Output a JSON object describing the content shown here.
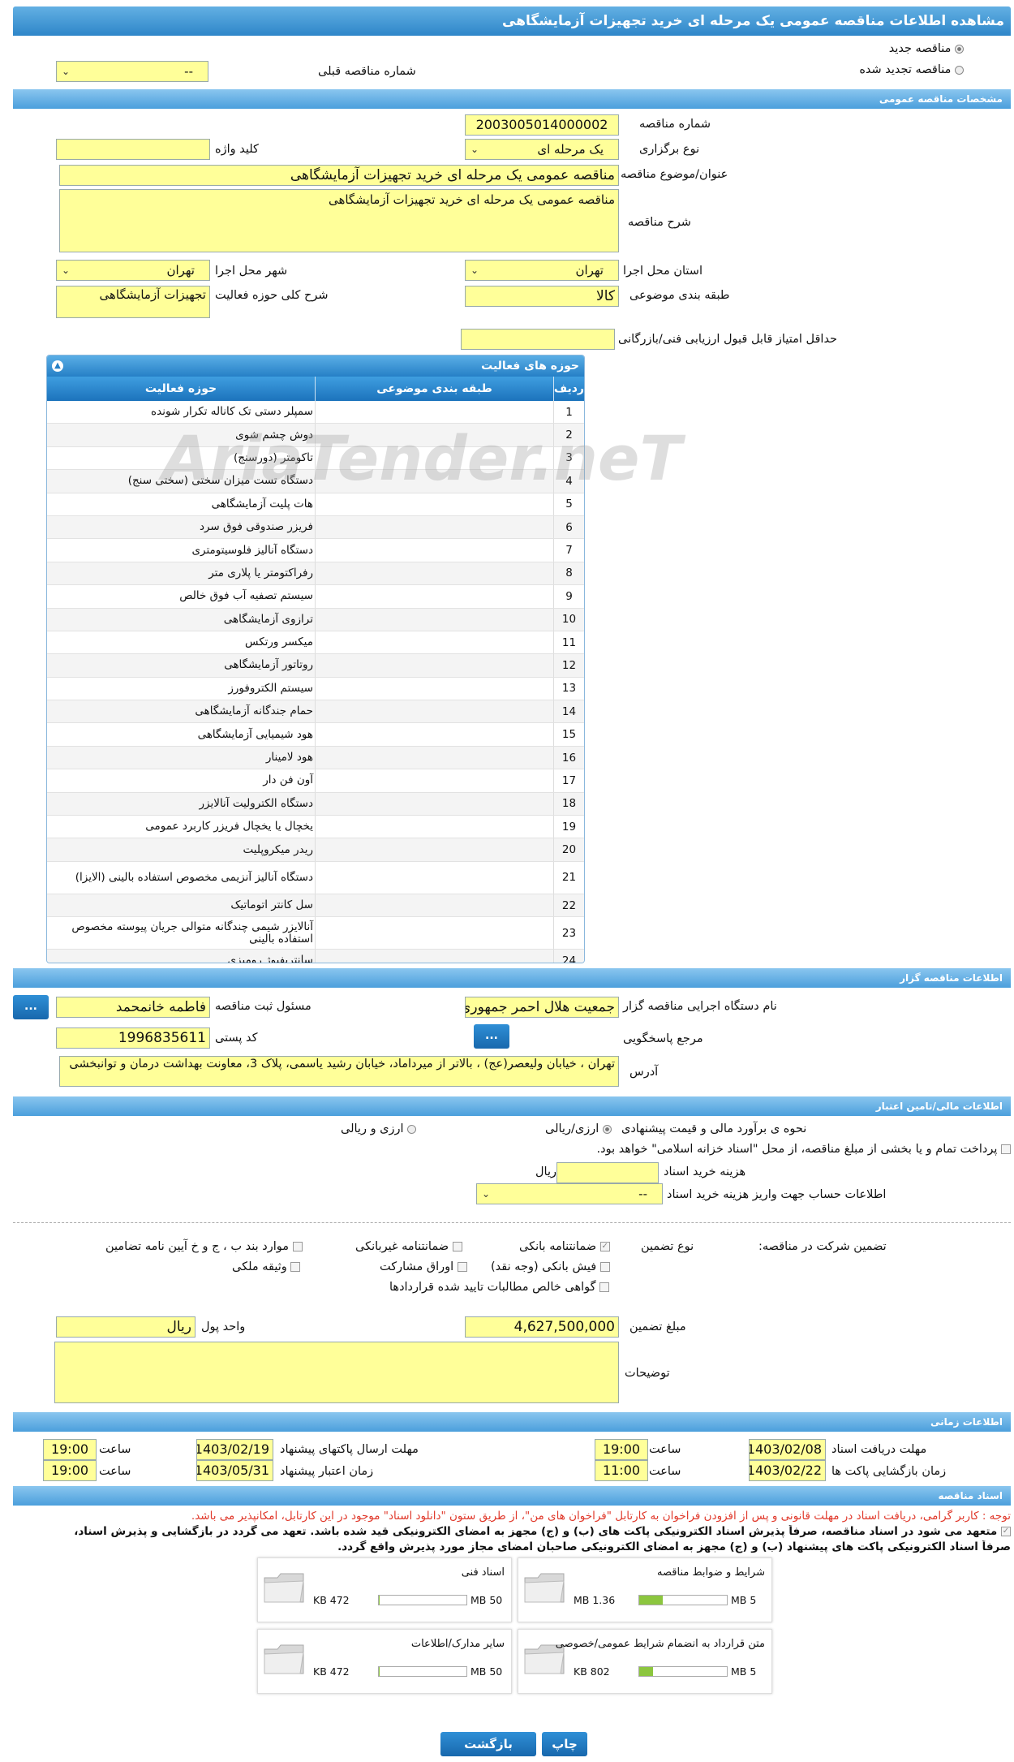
{
  "page": {
    "title": "مشاهده اطلاعات مناقصه عمومی یک مرحله ای خرید تجهیزات آزمایشگاهی"
  },
  "top": {
    "new_tender": "مناقصه جدید",
    "renewed_tender": "مناقصه تجدید شده",
    "prev_number_label": "شماره مناقصه قبلی",
    "prev_number_value": "--"
  },
  "general": {
    "header": "مشخصات مناقصه عمومی",
    "number_label": "شماره مناقصه",
    "number_value": "2003005014000002",
    "type_label": "نوع برگزاری",
    "type_value": "یک مرحله ای",
    "keyword_label": "کلید واژه",
    "keyword_value": "",
    "subject_label": "عنوان/موضوع مناقصه",
    "subject_value": "مناقصه عمومی یک مرحله ای خرید تجهیزات آزمایشگاهی",
    "desc_label": "شرح مناقصه",
    "desc_value": "مناقصه عمومی یک مرحله ای خرید تجهیزات آزمایشگاهی",
    "province_label": "استان محل اجرا",
    "province_value": "تهران",
    "city_label": "شهر محل اجرا",
    "city_value": "تهران",
    "category_label": "طبقه بندی موضوعی",
    "category_value": "کالا",
    "activity_label": "شرح کلی حوزه فعالیت",
    "activity_value": "تجهیزات آزمایشگاهی",
    "min_score_label": "حداقل امتیاز قابل قبول ارزیابی فنی/بازرگانی",
    "min_score_value": ""
  },
  "activities": {
    "header": "حوزه های فعالیت",
    "col_row": "ردیف",
    "col_category": "طبقه بندی موضوعی",
    "col_field": "حوزه فعالیت",
    "rows": [
      {
        "n": "1",
        "name": "سمپلر دستی تک کاناله تکرار شونده"
      },
      {
        "n": "2",
        "name": "دوش چشم شوی"
      },
      {
        "n": "3",
        "name": "تاکومتر (دورسنج)"
      },
      {
        "n": "4",
        "name": "دستگاه تست میزان سختی (سختی سنج)"
      },
      {
        "n": "5",
        "name": "هات پلیت آزمایشگاهی"
      },
      {
        "n": "6",
        "name": "فریزر صندوقی فوق سرد"
      },
      {
        "n": "7",
        "name": "دستگاه آنالیز فلوسیتومتری"
      },
      {
        "n": "8",
        "name": "رفراکتومتر یا پلاری متر"
      },
      {
        "n": "9",
        "name": "سیستم تصفیه آب فوق خالص"
      },
      {
        "n": "10",
        "name": "ترازوی آزمایشگاهی"
      },
      {
        "n": "11",
        "name": "میکسر ورتکس"
      },
      {
        "n": "12",
        "name": "روتاتور آزمایشگاهی"
      },
      {
        "n": "13",
        "name": "سیستم الکتروفورز"
      },
      {
        "n": "14",
        "name": "حمام جندگانه آزمایشگاهی"
      },
      {
        "n": "15",
        "name": "هود شیمیایی آزمایشگاهی"
      },
      {
        "n": "16",
        "name": "هود لامینار"
      },
      {
        "n": "17",
        "name": "آون فن دار"
      },
      {
        "n": "18",
        "name": "دستگاه الکترولیت آنالایزر"
      },
      {
        "n": "19",
        "name": "یخچال یا یخچال فریزر کاربرد عمومی"
      },
      {
        "n": "20",
        "name": "ریدر میکروپلیت"
      },
      {
        "n": "21",
        "name": "دستگاه آنالیز آنزیمی مخصوص استفاده بالینی (الایزا)"
      },
      {
        "n": "22",
        "name": "سل کانتر اتوماتیک"
      },
      {
        "n": "23",
        "name": "آنالایزر شیمی چندگانه متوالی جریان پیوسته مخصوص استفاده بالینی"
      },
      {
        "n": "24",
        "name": "سانتریفیوژ رومیزی"
      }
    ]
  },
  "organizer": {
    "header": "اطلاعات مناقصه گزار",
    "org_label": "نام دستگاه اجرایی مناقصه گزار",
    "org_value": "جمعیت هلال احمر جمهوری",
    "person_label": "مسئول ثبت مناقصه",
    "person_value": "فاطمه خانمحمد",
    "ref_label": "مرجع پاسخگویی",
    "postal_label": "کد پستی",
    "postal_value": "1996835611",
    "address_label": "آدرس",
    "address_value": "تهران ، خیابان ولیعصر(عج) ، بالاتر از میرداماد، خیابان رشید یاسمی، پلاک 3، معاونت بهداشت درمان و توانبخشی",
    "more_btn": "..."
  },
  "finance": {
    "header": "اطلاعات مالی/تامین اعتبار",
    "estimate_label": "نحوه ی برآورد مالی و قیمت پیشنهادی",
    "opt1": "ارزی/ریالی",
    "opt2": "ارزی و ریالی",
    "treasury_text": "پرداخت تمام و یا بخشی از مبلغ مناقصه، از محل \"اسناد خزانه اسلامی\" خواهد بود.",
    "doc_cost_label": "هزینه خرید اسناد",
    "doc_cost_unit": "ریال",
    "account_label": "اطلاعات حساب جهت واریز هزینه خرید اسناد",
    "account_value": "--",
    "guarantee_label": "تضمین شرکت در مناقصه:",
    "guarantee_type_label": "نوع تضمین",
    "g_bank": "ضمانتنامه بانکی",
    "g_nonbank": "ضمانتنامه غیربانکی",
    "g_items": "موارد بند ب ، ج و خ آیین نامه تضامین",
    "g_cheque": "فیش بانکی (وجه نقد)",
    "g_bonds": "اوراق مشارکت",
    "g_property": "وثیقه ملکی",
    "g_claims": "گواهی خالص مطالبات تایید شده قراردادها",
    "amount_label": "مبلغ تضمین",
    "amount_value": "4,627,500,000",
    "currency_label": "واحد پول",
    "currency_value": "ریال",
    "notes_label": "توضیحات"
  },
  "timing": {
    "header": "اطلاعات زمانی",
    "receive_label": "مهلت دریافت اسناد",
    "receive_date": "1403/02/08",
    "receive_time": "19:00",
    "send_label": "مهلت ارسال پاکتهای پیشنهاد",
    "send_date": "1403/02/19",
    "send_time": "19:00",
    "open_label": "زمان بازگشایی پاکت ها",
    "open_date": "1403/02/22",
    "open_time": "11:00",
    "valid_label": "زمان اعتبار پیشنهاد",
    "valid_date": "1403/05/31",
    "valid_time": "19:00",
    "time_label": "ساعت"
  },
  "documents": {
    "header": "اسناد مناقصه",
    "notice": "توجه : کاربر گرامی، دریافت اسناد در مهلت قانونی و پس از افزودن فراخوان به کارتابل \"فراخوان های من\"، از طریق ستون \"دانلود اسناد\" موجود در این کارتابل، امکانپذیر می باشد.",
    "commit1": "متعهد می شود در اسناد مناقصه، صرفاً پذیرش اسناد الکترونیکی پاکت های (ب) و (ج) مجهز به امضای الکترونیکی قید شده باشد. تعهد می گردد در بازگشایی و پذیرش اسناد،",
    "commit2": "صرفاً اسناد الکترونیکی پاکت های پیشنهاد (ب) و (ج) مجهز به امضای الکترونیکی صاحبان امضای مجاز مورد پذیرش واقع گردد.",
    "files": [
      {
        "name": "شرایط و ضوابط مناقصه",
        "size": "1.36 MB",
        "max": "5 MB",
        "fill": 0.27
      },
      {
        "name": "اسناد فنی",
        "size": "472 KB",
        "max": "50 MB",
        "fill": 0.01
      },
      {
        "name": "متن قرارداد به انضمام شرایط عمومی/خصوصی",
        "size": "802 KB",
        "max": "5 MB",
        "fill": 0.16
      },
      {
        "name": "سایر مدارک/اطلاعات",
        "size": "472 KB",
        "max": "50 MB",
        "fill": 0.01
      }
    ]
  },
  "footer": {
    "back": "بازگشت",
    "print": "چاپ"
  },
  "watermark": "AriaTender.neT"
}
